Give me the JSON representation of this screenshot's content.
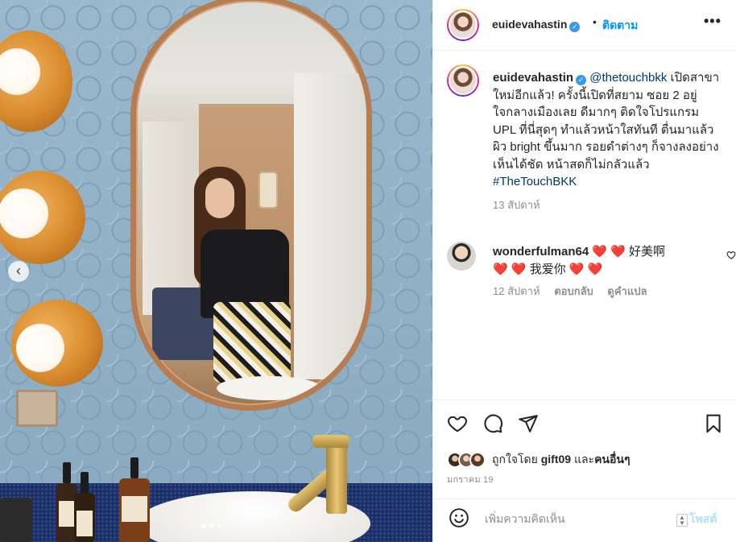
{
  "post": {
    "username": "euidevahastin",
    "separator": "•",
    "follow_label": "ติดตาม",
    "more_label": "•••",
    "verified_mark": "✓"
  },
  "caption": {
    "username": "euidevahastin",
    "mention": "@thetouchbkk",
    "text": " เปิดสาขาใหม่อีกแล้ว! ครั้งนี้เปิดที่สยาม ซอย 2 อยู่ใจกลางเมืองเลย ดีมากๆ ติดใจโปรแกรม UPL ที่นี่สุดๆ ทำแล้วหน้าใสทันที ตื่นมาแล้วผิว bright ขึ้นมาก รอยดำต่างๆ ก็จางลงอย่างเห็นได้ชัด หน้าสดก็ไม่กลัวแล้ว ",
    "hashtag": "#TheTouchBKK",
    "time": "13 สัปดาห์"
  },
  "comment": {
    "username": "wonderfulman64",
    "text_part1": "❤️ ❤️ 好美啊",
    "text_part2": "❤️ ❤️ 我爱你 ❤️ ❤️",
    "time": "12 สัปดาห์",
    "reply_label": "ตอบกลับ",
    "translate_label": "ดูคำแปล"
  },
  "actions": {
    "liked_by_prefix": "ถูกใจโดย",
    "liked_by_user": "gift09",
    "liked_by_and": "และ",
    "liked_by_others": "คนอื่นๆ",
    "date": "มกราคม 19"
  },
  "add_comment": {
    "placeholder": "เพิ่มความคิดเห็น",
    "post_label": "โพสต์"
  },
  "carousel": {
    "prev_label": "‹",
    "total_images": 3,
    "active_index": 0
  },
  "colors": {
    "accent": "#0095f6",
    "text": "#262626",
    "muted": "#8e8e8e",
    "link": "#00376b",
    "heart": "#e0245e",
    "post_disabled": "#b2dffc"
  },
  "icons": [
    "heart-icon",
    "comment-icon",
    "share-icon",
    "bookmark-icon",
    "emoji-icon",
    "more-icon",
    "verified-icon",
    "chevron-left-icon"
  ]
}
